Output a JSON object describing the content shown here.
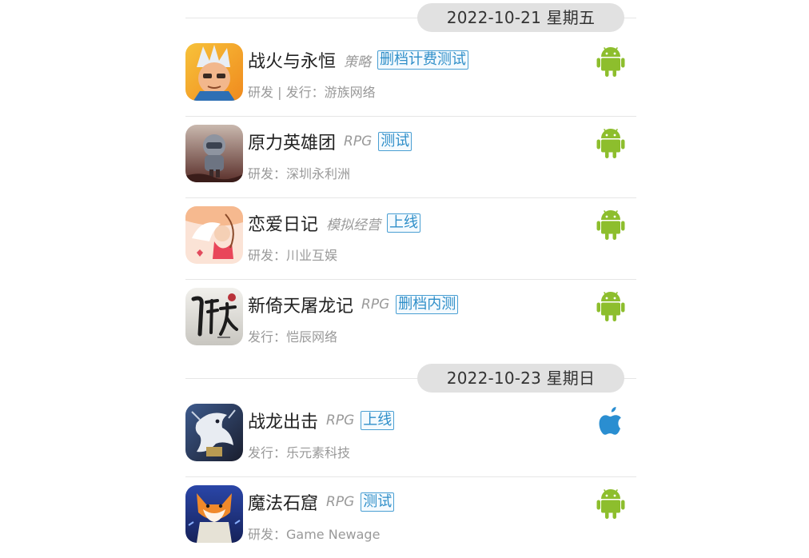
{
  "groups": [
    {
      "date": "2022-10-21 星期五",
      "games": [
        {
          "name": "战火与永恒",
          "genre": "策略",
          "badge": "删档计费测试",
          "company": "研发 | 发行：游族网络",
          "platform": "android-icon"
        },
        {
          "name": "原力英雄团",
          "genre": "RPG",
          "badge": "测试",
          "company": "研发：深圳永利洲",
          "platform": "android-icon"
        },
        {
          "name": "恋爱日记",
          "genre": "模拟经营",
          "badge": "上线",
          "company": "研发：川业互娱",
          "platform": "android-icon"
        },
        {
          "name": "新倚天屠龙记",
          "genre": "RPG",
          "badge": "删档内测",
          "company": "发行：恺辰网络",
          "platform": "android-icon"
        }
      ]
    },
    {
      "date": "2022-10-23 星期日",
      "games": [
        {
          "name": "战龙出击",
          "genre": "RPG",
          "badge": "上线",
          "company": "发行：乐元素科技",
          "platform": "apple-icon"
        },
        {
          "name": "魔法石窟",
          "genre": "RPG",
          "badge": "测试",
          "company": "研发：Game Newage",
          "platform": "android-icon"
        }
      ]
    }
  ],
  "icons": {
    "game_icon_1": "warrior-portrait-icon",
    "game_icon_2": "armored-hero-icon",
    "game_icon_3": "cupid-angel-icon",
    "game_icon_4": "calligraphy-logo-icon",
    "game_icon_5": "white-dragon-icon",
    "game_icon_6": "fox-character-icon"
  },
  "colors": {
    "android_green": "#8dbe2d",
    "apple_blue": "#2a8ed1",
    "badge_blue": "#2f8fc9",
    "date_pill_bg": "#e1e1e1"
  }
}
